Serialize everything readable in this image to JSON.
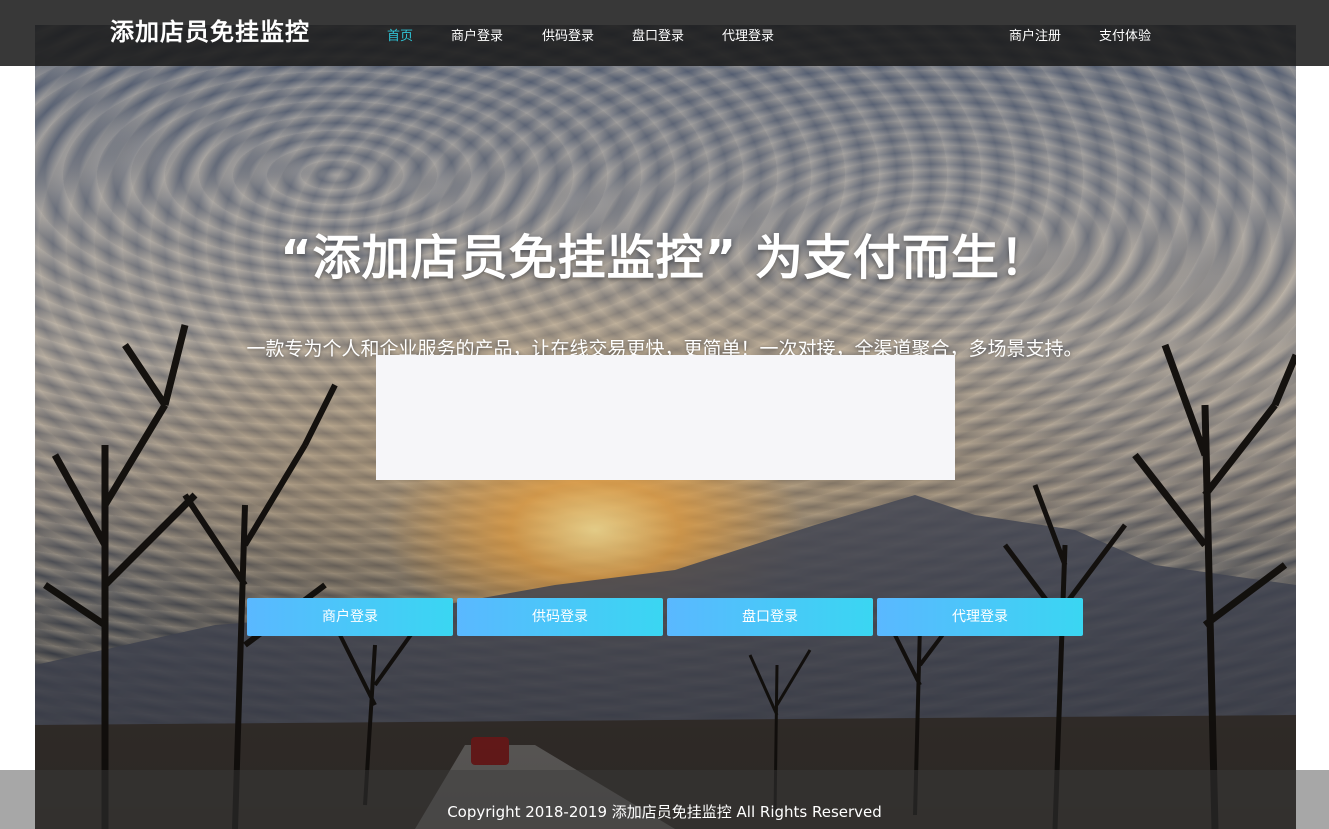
{
  "brand": {
    "title": "添加店员免挂监控"
  },
  "nav": {
    "home": "首页",
    "merchant_login": "商户登录",
    "supplier_login": "供码登录",
    "panel_login": "盘口登录",
    "agent_login": "代理登录",
    "merchant_register": "商户注册",
    "pay_trial": "支付体验",
    "active_color": "#2fc4d6"
  },
  "hero": {
    "headline": "“添加店员免挂监控” 为支付而生！",
    "subline": "一款专为个人和企业服务的产品，让在线交易更快，更简单！一次对接，全渠道聚合，多场景支持。"
  },
  "buttons": {
    "merchant_login": "商户登录",
    "supplier_login": "供码登录",
    "panel_login": "盘口登录",
    "agent_login": "代理登录",
    "gradient_start": "#5ab8ff",
    "gradient_end": "#3ad6f2"
  },
  "footer": {
    "copyright": "Copyright 2018-2019 添加店员免挂监控 All Rights Reserved"
  }
}
